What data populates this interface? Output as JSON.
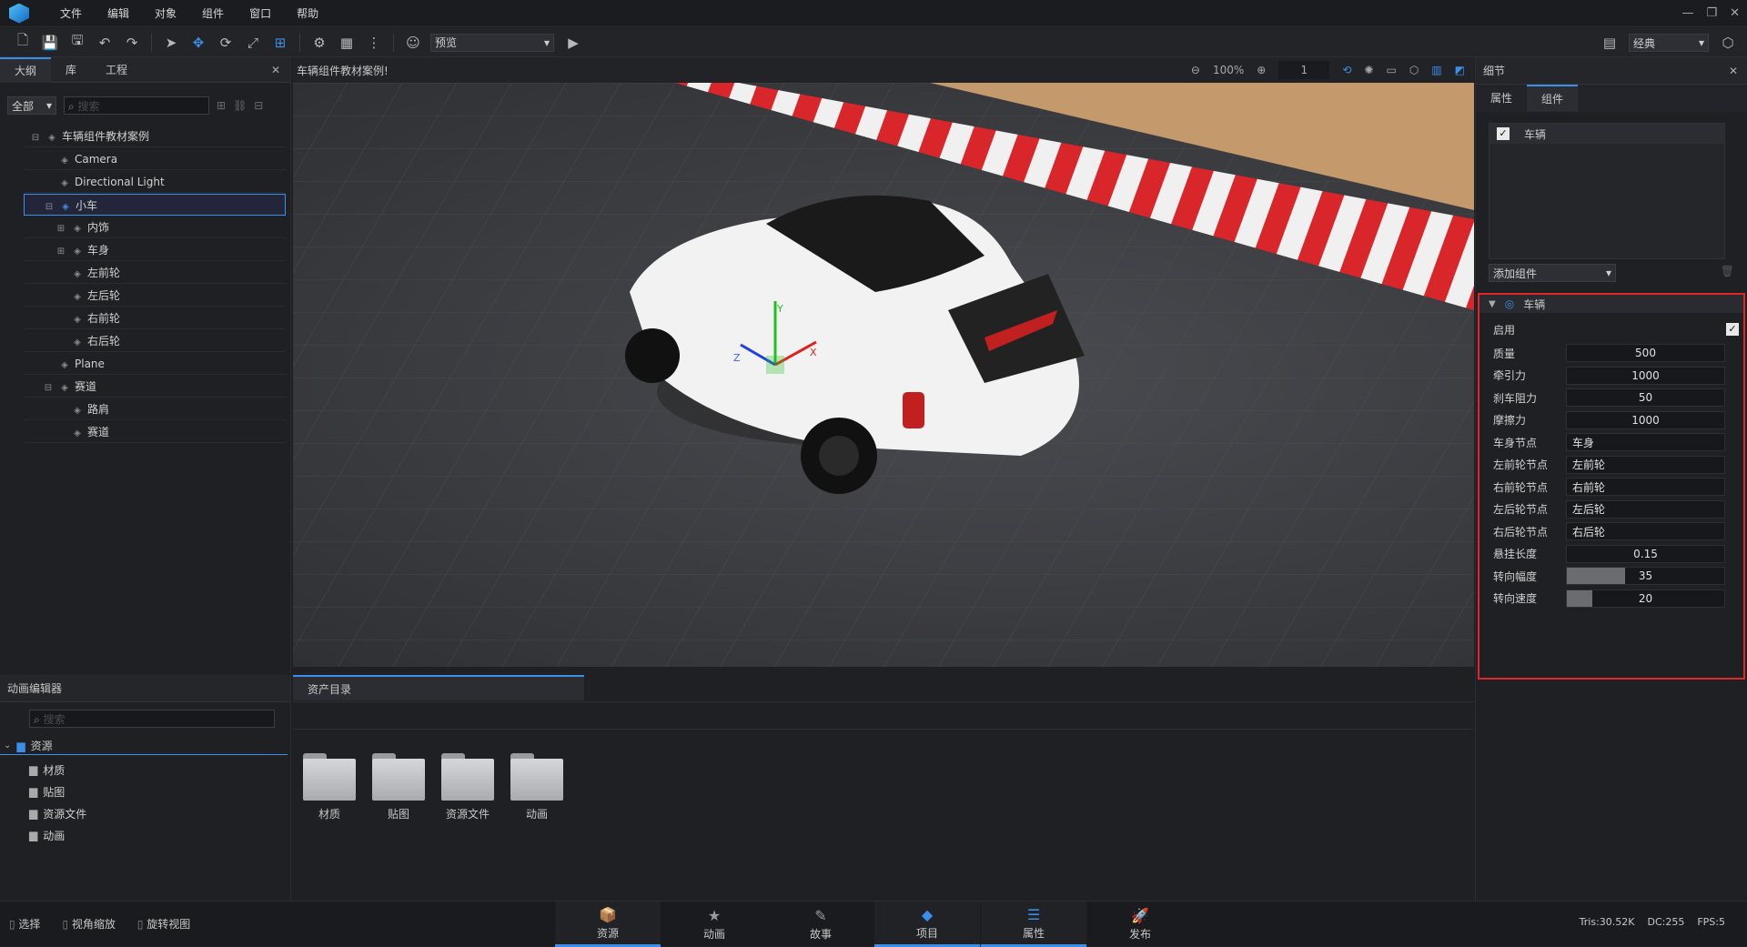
{
  "menu": [
    "文件",
    "编辑",
    "对象",
    "组件",
    "窗口",
    "帮助"
  ],
  "window_controls": [
    "—",
    "❐",
    "✕"
  ],
  "toolbar": {
    "mode_select": "预览",
    "layout_select": "经典"
  },
  "outline": {
    "tabs": [
      "大纲",
      "库",
      "工程"
    ],
    "filter": "全部",
    "search_placeholder": "搜索",
    "tree": [
      {
        "label": "车辆组件教材案例",
        "indent": 0,
        "exp": "⊟"
      },
      {
        "label": "Camera",
        "indent": 1,
        "exp": ""
      },
      {
        "label": "Directional Light",
        "indent": 1,
        "exp": ""
      },
      {
        "label": "小车",
        "indent": 1,
        "exp": "⊟",
        "selected": true
      },
      {
        "label": "内饰",
        "indent": 2,
        "exp": "⊞"
      },
      {
        "label": "车身",
        "indent": 2,
        "exp": "⊞"
      },
      {
        "label": "左前轮",
        "indent": 2,
        "exp": ""
      },
      {
        "label": "左后轮",
        "indent": 2,
        "exp": ""
      },
      {
        "label": "右前轮",
        "indent": 2,
        "exp": ""
      },
      {
        "label": "右后轮",
        "indent": 2,
        "exp": ""
      },
      {
        "label": "Plane",
        "indent": 1,
        "exp": ""
      },
      {
        "label": "赛道",
        "indent": 1,
        "exp": "⊟"
      },
      {
        "label": "路肩",
        "indent": 2,
        "exp": ""
      },
      {
        "label": "赛道",
        "indent": 2,
        "exp": ""
      }
    ]
  },
  "viewport": {
    "title": "车辆组件教材案例!",
    "zoom": "100%",
    "frame": "1",
    "axes": {
      "x": "X",
      "y": "Y",
      "z": "Z"
    }
  },
  "details": {
    "title": "细节",
    "tabs": [
      "属性",
      "组件"
    ],
    "component_name": "车辆",
    "add_component": "添加组件",
    "section_title": "车辆",
    "enabled_label": "启用",
    "props": [
      {
        "label": "质量",
        "value": "500",
        "center": true
      },
      {
        "label": "牵引力",
        "value": "1000",
        "center": true
      },
      {
        "label": "刹车阻力",
        "value": "50",
        "center": true
      },
      {
        "label": "摩擦力",
        "value": "1000",
        "center": true
      },
      {
        "label": "车身节点",
        "value": "车身",
        "center": false
      },
      {
        "label": "左前轮节点",
        "value": "左前轮",
        "center": false
      },
      {
        "label": "右前轮节点",
        "value": "右前轮",
        "center": false
      },
      {
        "label": "左后轮节点",
        "value": "左后轮",
        "center": false
      },
      {
        "label": "右后轮节点",
        "value": "右后轮",
        "center": false
      },
      {
        "label": "悬挂长度",
        "value": "0.15",
        "center": true
      },
      {
        "label": "转向幅度",
        "value": "35",
        "center": true,
        "fill": 0.37
      },
      {
        "label": "转向速度",
        "value": "20",
        "center": true,
        "fill": 0.16
      }
    ]
  },
  "anim": {
    "title": "动画编辑器",
    "search_placeholder": "搜索",
    "root": "资源",
    "folders": [
      "材质",
      "贴图",
      "资源文件",
      "动画"
    ]
  },
  "assets": {
    "tab": "资产目录",
    "folders": [
      "材质",
      "贴图",
      "资源文件",
      "动画"
    ]
  },
  "status": {
    "left": [
      "选择",
      "视角缩放",
      "旋转视图"
    ],
    "tabs": [
      {
        "label": "资源",
        "active": true
      },
      {
        "label": "动画",
        "active": false
      },
      {
        "label": "故事",
        "active": false
      },
      {
        "label": "项目",
        "active": true
      },
      {
        "label": "属性",
        "active": true
      },
      {
        "label": "发布",
        "active": false
      }
    ],
    "stats": {
      "tris": "Tris:30.52K",
      "dc": "DC:255",
      "fps": "FPS:5"
    }
  },
  "colors": {
    "accent": "#3b8fe8",
    "highlight_box": "#e02828",
    "background": "#1f2023"
  }
}
